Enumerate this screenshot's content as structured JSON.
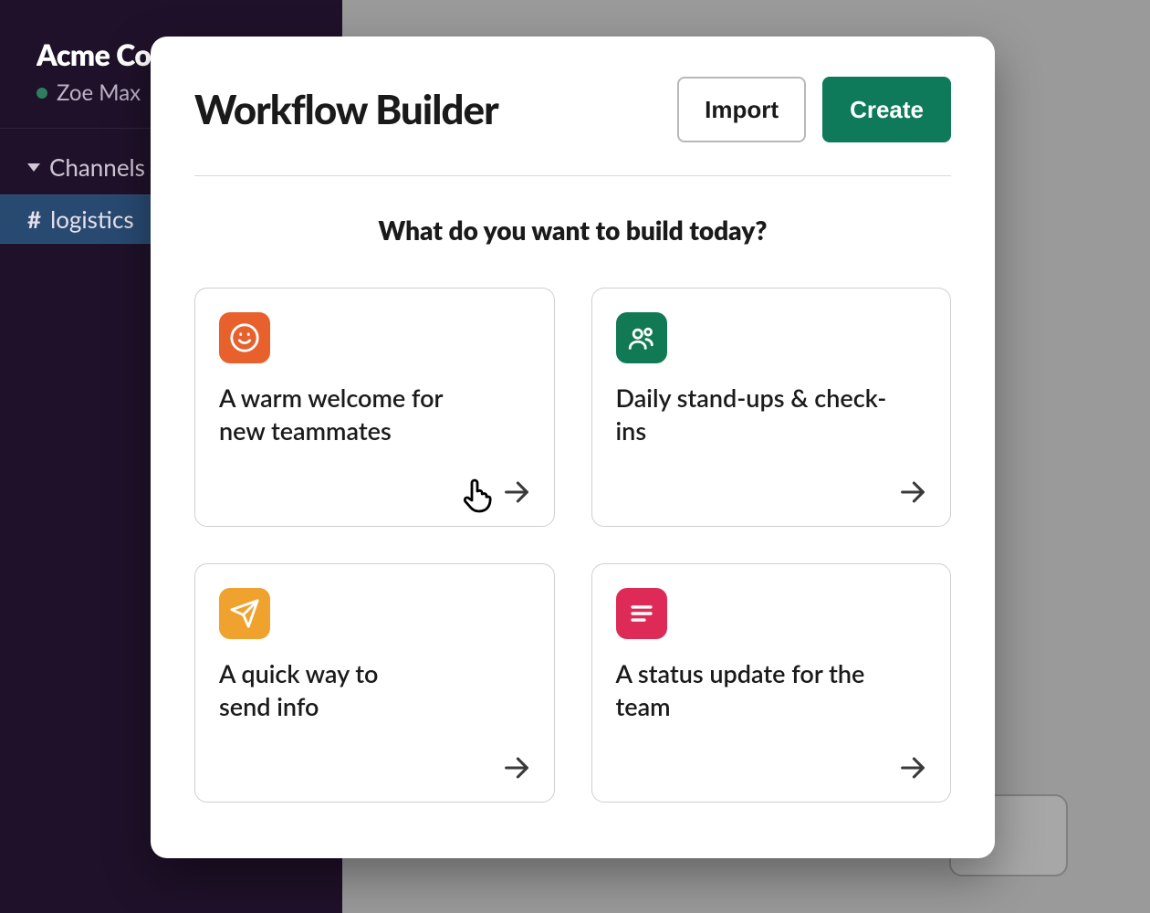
{
  "colors": {
    "primary": "#0e7a5a",
    "sidebar_bg": "#1f1129",
    "card_icon_orange": "#e8602b",
    "card_icon_green": "#117a55",
    "card_icon_yellow": "#f0a22e",
    "card_icon_pink": "#de2a57",
    "channel_active_bg": "#284a71"
  },
  "sidebar": {
    "workspace_name": "Acme Co",
    "user_name": "Zoe Max",
    "section_label": "Channels",
    "active_channel": "logistics"
  },
  "modal": {
    "title": "Workflow Builder",
    "import_label": "Import",
    "create_label": "Create",
    "prompt": "What do you want to build today?",
    "cards": [
      {
        "id": "welcome",
        "icon": "smile-icon",
        "icon_color": "orange",
        "title": "A warm welcome for new teammates"
      },
      {
        "id": "standup",
        "icon": "people-icon",
        "icon_color": "green",
        "title": "Daily stand-ups & check-ins"
      },
      {
        "id": "sendinfo",
        "icon": "paper-plane-icon",
        "icon_color": "yellow",
        "title": "A quick way to send info"
      },
      {
        "id": "status",
        "icon": "lines-icon",
        "icon_color": "pink",
        "title": "A status update for the team"
      }
    ]
  }
}
